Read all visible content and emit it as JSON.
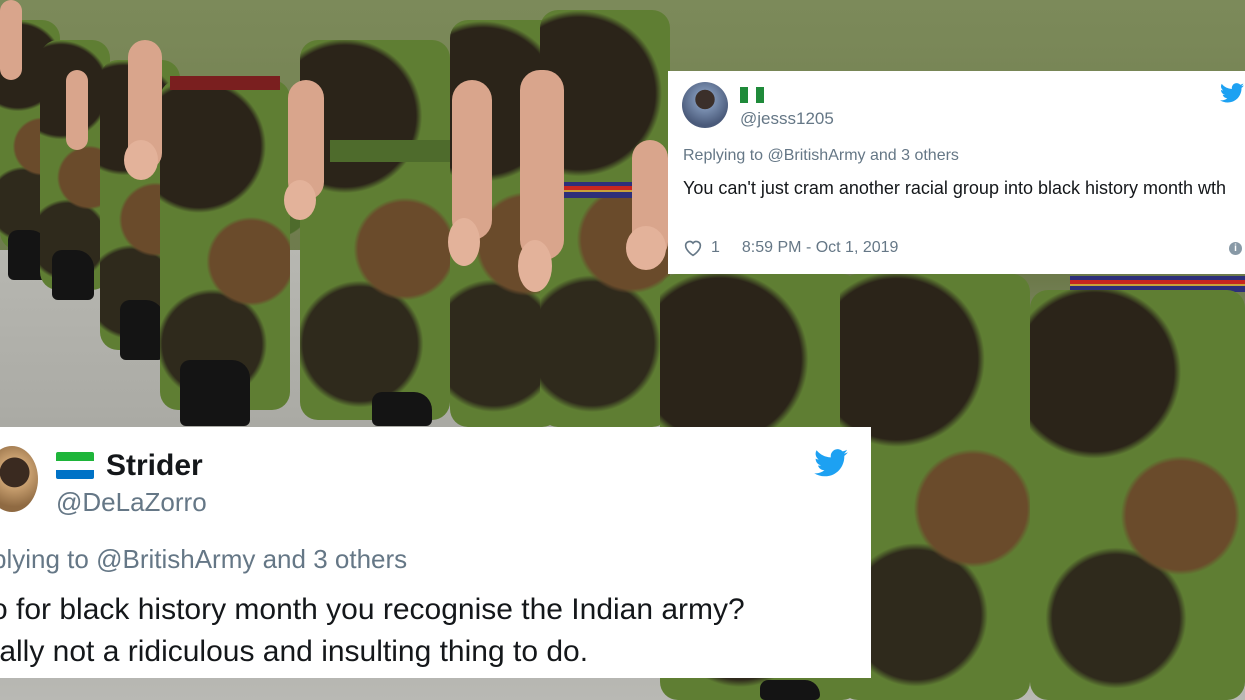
{
  "background": {
    "description_color_camouflage": "#5f7e33"
  },
  "tweet_top": {
    "handle": "@jesss1205",
    "flag_colors": [
      "#1f8a3a",
      "#ffffff",
      "#1f8a3a"
    ],
    "reply_prefix": "Replying to ",
    "reply_target": "@BritishArmy",
    "reply_suffix": " and 3 others",
    "text": "You can't just cram another racial group into black history month wth",
    "likes": "1",
    "timestamp": "8:59 PM - Oct 1, 2019",
    "icons": [
      "heart-icon",
      "twitter-bird-icon",
      "info-icon"
    ]
  },
  "tweet_bottom": {
    "display_name": "Strider",
    "handle": "@DeLaZorro",
    "flag_colors": [
      "#1eb53a",
      "#ffffff",
      "#0072c6"
    ],
    "reply_prefix": "plying to ",
    "reply_target": "@BritishArmy",
    "reply_suffix": " and 3 others",
    "text_line1": "o for black history month you recognise the Indian army?",
    "text_line2": "tally not a ridiculous and insulting thing to do.",
    "icons": [
      "twitter-bird-icon"
    ]
  },
  "colors": {
    "twitter_blue": "#1da1f2",
    "link_blue": "#1b95e0",
    "meta_gray": "#657786"
  }
}
